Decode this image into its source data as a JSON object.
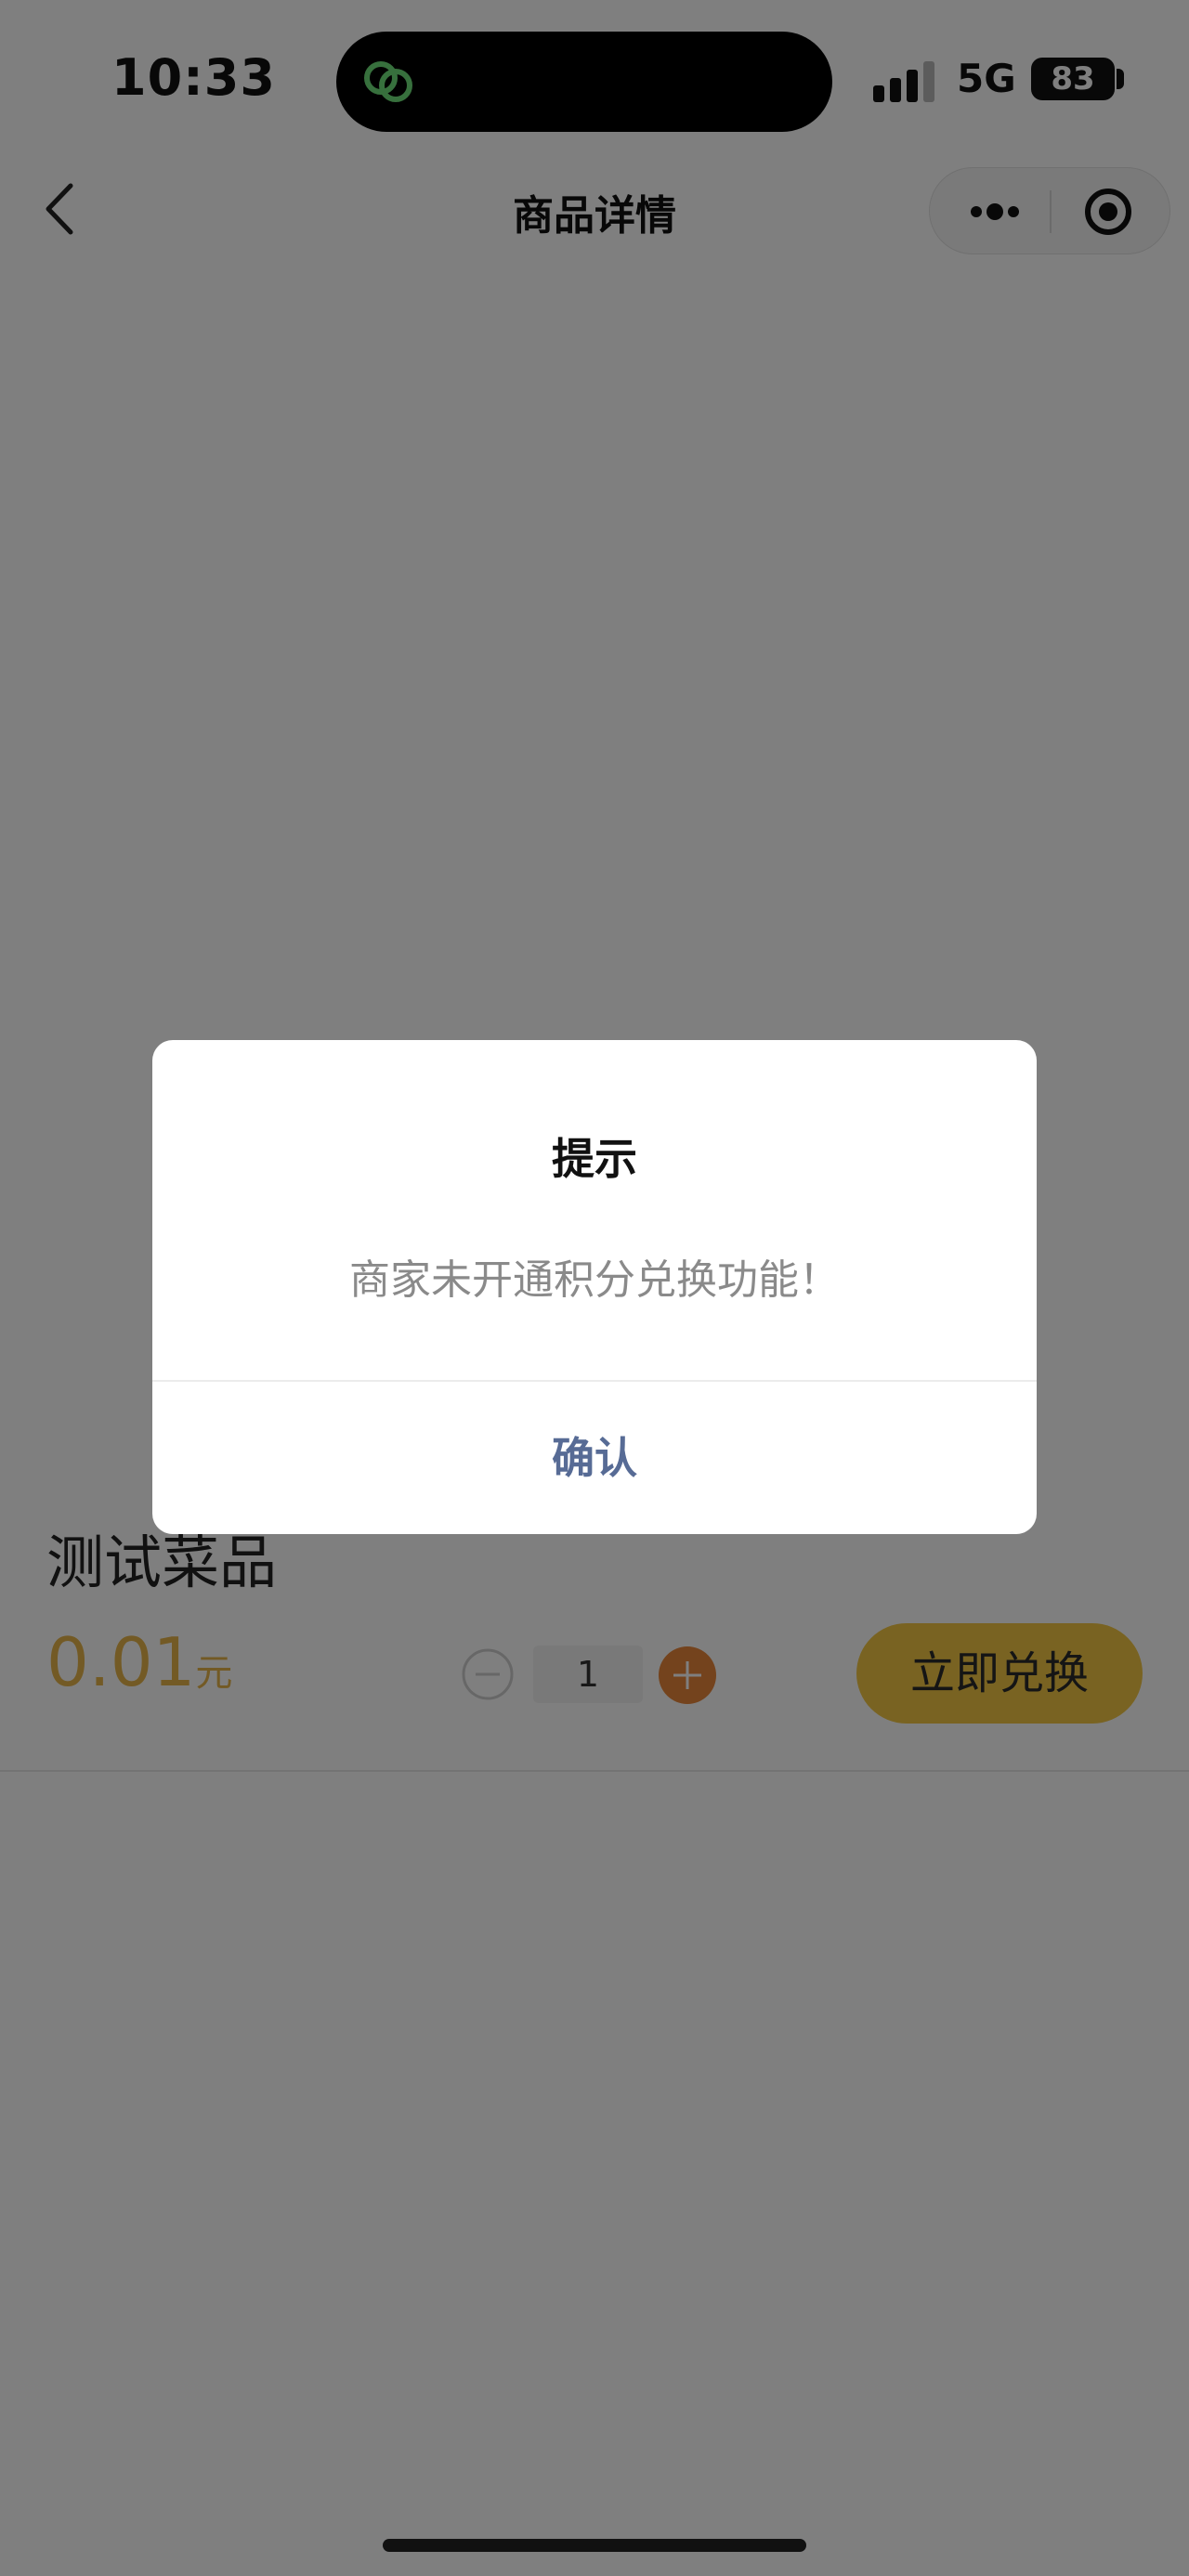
{
  "status_bar": {
    "time": "10:33",
    "network": "5G",
    "battery": "83"
  },
  "nav": {
    "title": "商品详情"
  },
  "product": {
    "name": "测试菜品",
    "price_value": "0.01",
    "price_unit": "元",
    "quantity": "1",
    "redeem_label": "立即兑换"
  },
  "dialog": {
    "title": "提示",
    "message": "商家未开通积分兑换功能！",
    "confirm_label": "确认"
  },
  "colors": {
    "accent": "#e6b54a",
    "button": "#f2c744",
    "plus_button": "#e8863a",
    "confirm_text": "#576b95",
    "island_icon": "#6ee07a"
  },
  "icons": {
    "back": "chevron-left-icon",
    "more": "more-dots-icon",
    "close": "target-icon",
    "island": "link-icon",
    "minus": "minus-circle-icon",
    "plus": "plus-circle-icon"
  }
}
